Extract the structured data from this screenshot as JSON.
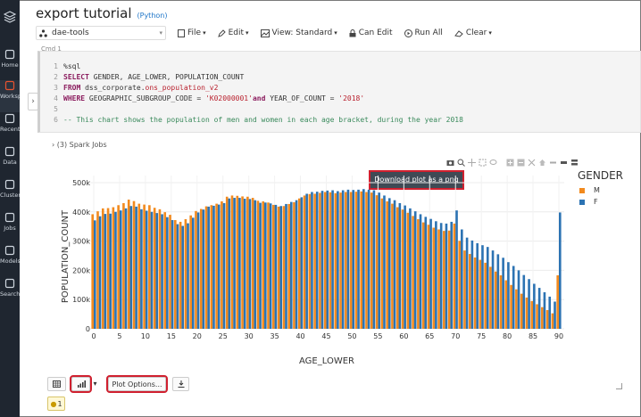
{
  "notebook": {
    "title": "export tutorial",
    "language": "(Python)"
  },
  "sidebar": {
    "items": [
      {
        "label": "Home",
        "icon": "home-icon"
      },
      {
        "label": "Workspace",
        "icon": "workspace-icon"
      },
      {
        "label": "Recents",
        "icon": "clock-icon"
      },
      {
        "label": "Data",
        "icon": "data-icon"
      },
      {
        "label": "Clusters",
        "icon": "clusters-icon"
      },
      {
        "label": "Jobs",
        "icon": "calendar-icon"
      },
      {
        "label": "Models",
        "icon": "models-icon"
      },
      {
        "label": "Search",
        "icon": "search-icon"
      }
    ]
  },
  "toolbar": {
    "cluster": "dae-tools",
    "file": "File",
    "edit": "Edit",
    "view": "View: Standard",
    "can_edit": "Can Edit",
    "run_all": "Run All",
    "clear": "Clear"
  },
  "cell": {
    "label": "Cmd 1",
    "line_numbers": [
      "1",
      "2",
      "3",
      "4",
      "5",
      "6"
    ],
    "lines": [
      [
        {
          "t": "%sql",
          "c": "plain"
        }
      ],
      [
        {
          "t": "SELECT",
          "c": "kw"
        },
        {
          "t": " GENDER, AGE_LOWER, POPULATION_COUNT",
          "c": "plain"
        }
      ],
      [
        {
          "t": "FROM",
          "c": "kw"
        },
        {
          "t": " dss_corporate.",
          "c": "plain"
        },
        {
          "t": "ons_population_v2",
          "c": "str"
        }
      ],
      [
        {
          "t": "WHERE",
          "c": "kw"
        },
        {
          "t": " GEOGRAPHIC_SUBGROUP_CODE = ",
          "c": "plain"
        },
        {
          "t": "'K02000001'",
          "c": "str"
        },
        {
          "t": "and",
          "c": "kw"
        },
        {
          "t": " YEAR_OF_COUNT = ",
          "c": "plain"
        },
        {
          "t": "'2018'",
          "c": "str"
        }
      ],
      [
        {
          "t": "",
          "c": "plain"
        }
      ],
      [
        {
          "t": "-- This chart shows the population of men and women in each age bracket, during the year 2018",
          "c": "cmt"
        }
      ]
    ],
    "spark_jobs": "(3) Spark Jobs"
  },
  "tooltip": "Download plot as a png",
  "bottom": {
    "plot_options": "Plot Options...",
    "badge": "1"
  },
  "colors": {
    "M": "#f28a1e",
    "F": "#2c73b3",
    "highlight": "#d0202f"
  },
  "chart_data": {
    "type": "bar",
    "xlabel": "AGE_LOWER",
    "ylabel": "POPULATION_COUNT",
    "legend_title": "GENDER",
    "legend_position": "right",
    "xlim": [
      0,
      90
    ],
    "ylim": [
      0,
      500000
    ],
    "xticks": [
      0,
      5,
      10,
      15,
      20,
      25,
      30,
      35,
      40,
      45,
      50,
      55,
      60,
      65,
      70,
      75,
      80,
      85,
      90
    ],
    "xtick_labels": [
      "0",
      "5",
      "10",
      "15",
      "20",
      "25",
      "30",
      "35",
      "40",
      "45",
      "50",
      "55",
      "60",
      "65",
      "70",
      "75",
      "80",
      "85",
      "90"
    ],
    "yticks": [
      0,
      100000,
      200000,
      300000,
      400000,
      500000
    ],
    "ytick_labels": [
      "0",
      "100k",
      "200k",
      "300k",
      "400k",
      "500k"
    ],
    "x": [
      0,
      1,
      2,
      3,
      4,
      5,
      6,
      7,
      8,
      9,
      10,
      11,
      12,
      13,
      14,
      15,
      16,
      17,
      18,
      19,
      20,
      21,
      22,
      23,
      24,
      25,
      26,
      27,
      28,
      29,
      30,
      31,
      32,
      33,
      34,
      35,
      36,
      37,
      38,
      39,
      40,
      41,
      42,
      43,
      44,
      45,
      46,
      47,
      48,
      49,
      50,
      51,
      52,
      53,
      54,
      55,
      56,
      57,
      58,
      59,
      60,
      61,
      62,
      63,
      64,
      65,
      66,
      67,
      68,
      69,
      70,
      71,
      72,
      73,
      74,
      75,
      76,
      77,
      78,
      79,
      80,
      81,
      82,
      83,
      84,
      85,
      86,
      87,
      88,
      89,
      90
    ],
    "series": [
      {
        "name": "M",
        "values": [
          392000,
          402000,
          412000,
          413000,
          416000,
          423000,
          430000,
          442000,
          437000,
          428000,
          425000,
          423000,
          414000,
          409000,
          399000,
          390000,
          372000,
          366000,
          375000,
          388000,
          403000,
          410000,
          419000,
          423000,
          428000,
          436000,
          452000,
          456000,
          455000,
          453000,
          452000,
          448000,
          438000,
          436000,
          432000,
          424000,
          418000,
          420000,
          427000,
          433000,
          446000,
          456000,
          461000,
          462000,
          465000,
          468000,
          467000,
          464000,
          466000,
          468000,
          468000,
          469000,
          470000,
          468000,
          466000,
          457000,
          446000,
          436000,
          428000,
          416000,
          408000,
          397000,
          386000,
          375000,
          364000,
          356000,
          346000,
          340000,
          335000,
          336000,
          360000,
          301000,
          268000,
          256000,
          244000,
          236000,
          226000,
          212000,
          196000,
          183000,
          166000,
          150000,
          135000,
          120000,
          107000,
          95000,
          84000,
          74000,
          64000,
          53000,
          183000
        ]
      },
      {
        "name": "F",
        "values": [
          371000,
          385000,
          393000,
          394000,
          400000,
          405000,
          412000,
          420000,
          418000,
          409000,
          404000,
          400000,
          396000,
          392000,
          382000,
          372000,
          358000,
          352000,
          361000,
          380000,
          398000,
          408000,
          418000,
          421000,
          425000,
          430000,
          446000,
          448000,
          448000,
          445000,
          444000,
          440000,
          431000,
          432000,
          429000,
          424000,
          420000,
          427000,
          434000,
          440000,
          450000,
          462000,
          468000,
          469000,
          472000,
          473000,
          474000,
          471000,
          474000,
          476000,
          475000,
          476000,
          478000,
          476000,
          474000,
          466000,
          456000,
          447000,
          440000,
          430000,
          422000,
          412000,
          402000,
          392000,
          383000,
          376000,
          368000,
          362000,
          360000,
          366000,
          405000,
          340000,
          312000,
          302000,
          293000,
          286000,
          280000,
          268000,
          255000,
          243000,
          228000,
          215000,
          200000,
          184000,
          170000,
          154000,
          140000,
          125000,
          110000,
          93000,
          398000
        ]
      }
    ]
  }
}
